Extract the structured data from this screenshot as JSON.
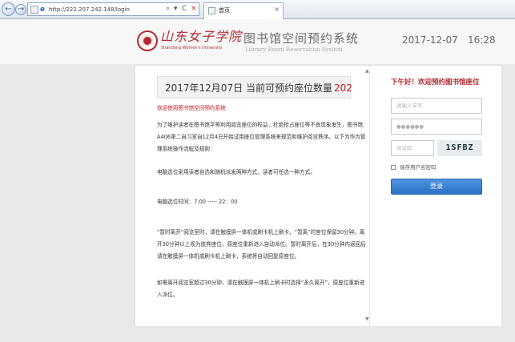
{
  "browser": {
    "url": "http://222.207.242.148/login",
    "tab_title": "首页",
    "tab_close": "×",
    "back_icon": "←",
    "forward_icon": "→",
    "search_icon": "⌕",
    "dropdown_icon": "▾",
    "refresh_icon": "C",
    "close_icon": "×"
  },
  "header": {
    "logo_cn": "山东女子学院",
    "logo_en": "Shandong Women's University",
    "system_title": "图书馆空间预约系统",
    "system_subtitle": "Library Room Reservation System",
    "date": "2017-12-07",
    "time": "16:28"
  },
  "notice": {
    "date": "2017年12月07日",
    "seats_label": "当前可预约座位数量",
    "seats_count": "202",
    "welcome": "欢迎使用图书馆空间预约系统",
    "paragraphs": [
      "为了维护读者在图书馆平等利用阅览座位的权益，杜绝抢占座位等不良现象发生，图书馆A406第二自习室自12月4日开始试用座位管理系统来规范和维护阅览秩序。以下为作为管理系统操作流程及规则：",
      "电脑选位采用读者自选和随机派发两种方式，读者可任选一种方式。",
      "电脑选位时间：7:00 ----- 22：00",
      "“暂时离开”阅览室时，请在触摸屏一体机或刷卡机上刷卡，“暂离”时座位保留30分钟。离开30分钟以上视为放弃座位，原座位重新进入自动派位。暂时离开后，在30分钟内返回后请在触摸屏一体机或刷卡机上刷卡，系统将自动回复原座位。",
      "如需离开阅览室超过30分钟，请在触摸屏一体机上刷卡时选择“永久离开”，原座位重新进入派位。"
    ]
  },
  "login": {
    "greeting": "下午好！欢迎预约图书馆座位",
    "username_placeholder": "请输入学号",
    "password_placeholder": "●●●●●●",
    "captcha_placeholder": "验证码",
    "captcha_text": "1SFBZ",
    "remember_label": "保存用户名密码",
    "submit_label": "登录"
  },
  "colors": {
    "brand_red": "#b1282f",
    "accent_red": "#c6171d",
    "button_blue": "#2a72c8"
  }
}
